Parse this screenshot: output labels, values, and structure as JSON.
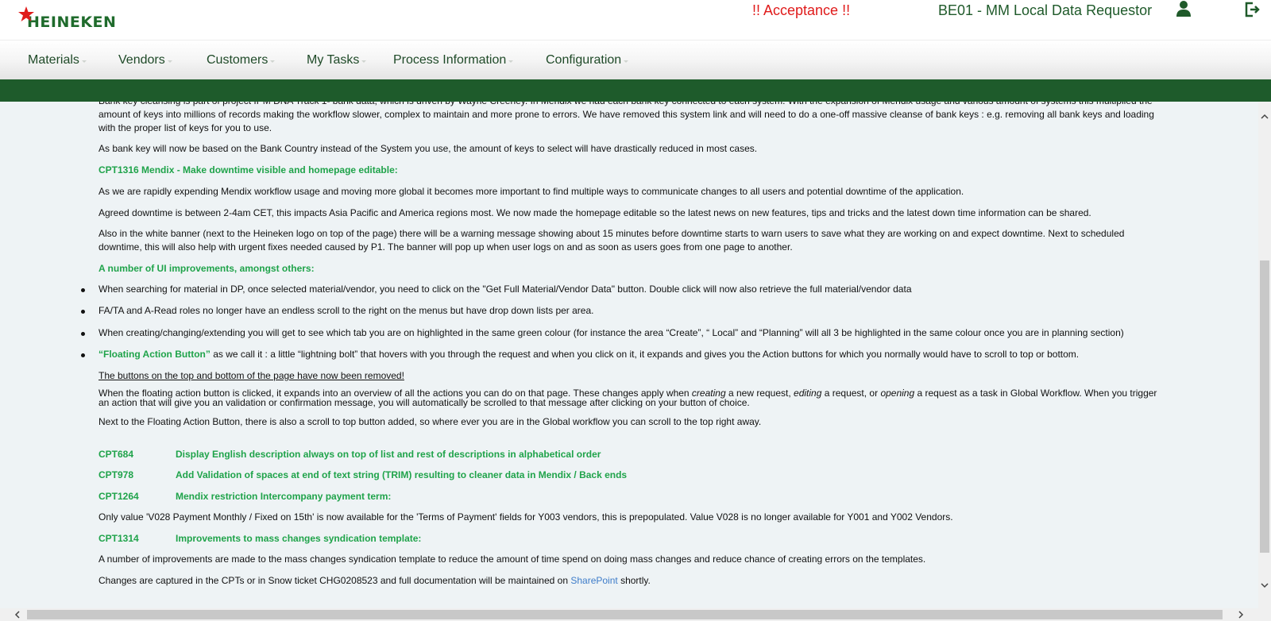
{
  "header": {
    "brand": "HEINEKEN",
    "env_warning": "!! Acceptance !!",
    "role_label": "BE01 - MM Local Data Requestor",
    "user_icon": "user-icon",
    "logout_icon": "logout-icon",
    "colors": {
      "brand_green": "#1f6b2c",
      "warning_red": "#e01b1b",
      "green_bar": "#1e5b2b",
      "highlight_green": "#1fa34a"
    }
  },
  "nav": {
    "items": [
      {
        "label": "Materials"
      },
      {
        "label": "Vendors"
      },
      {
        "label": "Customers"
      },
      {
        "label": "My Tasks"
      },
      {
        "label": "Process Information"
      },
      {
        "label": "Configuration"
      }
    ]
  },
  "content": {
    "intro": "Bank key cleansing is part of project IPM DNA Track 1- bank data, which is driven by Wayne Creeney. In Mendix we had each bank key connected to each system. With the expansion of Mendix usage and various amount of systems this multiplied the amount of keys into millions of records making the workflow slower, complex to maintain and more prone to errors. We have removed this system link and will need to do a one-off massive cleanse of bank keys : e.g. removing all bank keys and loading with the proper list of keys for you to use.",
    "bank_country": "As bank key will now be based on the Bank Country instead of the System you use, the amount of keys to select will have drastically reduced in most cases.",
    "cpt1316_heading": "CPT1316  Mendix - Make downtime visible and homepage editable:",
    "cpt1316_p1": "As we are rapidly expending Mendix workflow usage and moving more global it becomes more important to find multiple ways to communicate changes to all users and potential downtime of the application.",
    "cpt1316_p2": "Agreed downtime is between 2-4am CET, this impacts Asia Pacific and America regions most. We now made the homepage editable so the latest news on new features, tips and tricks and the latest down time information can be shared.",
    "cpt1316_p3": "Also in the white banner (next to the Heineken logo on top of the page) there will be a warning message showing about 15 minutes before downtime starts to warn users to save what they are working on and expect downtime. Next to scheduled downtime, this will also help with urgent fixes needed caused by P1. The banner will pop up when user logs on and as soon as users goes from one page to another.",
    "ui_heading": "A number of UI improvements, amongst others:",
    "bullets": [
      "When searching for material in DP, once selected material/vendor, you need to click on the \"Get Full Material/Vendor Data\" button. Double click will now also retrieve the full material/vendor data",
      "FA/TA and A-Read roles no longer have an endless scroll to the right on the menus but have drop down lists per area.",
      "When creating/changing/extending you will get to see which tab you are on highlighted in the same green colour (for instance the area “Create”, “ Local”  and  “Planning” will all 3 be highlighted in the same colour once you are in planning section)"
    ],
    "fab_label": "“Floating Action Button”",
    "fab_text": " as we call it :  a little “lightning bolt” that hovers with you through the request and when you click on it, it expands and gives you the Action buttons for which you normally would have to scroll to top or bottom.",
    "removed_note": "The buttons on the top and bottom of the page have now been removed!",
    "fab_detail_1": "When the floating action button is clicked, it expands into an overview of all the actions you can do on that page. These changes apply when ",
    "fab_detail_em1": "creating",
    "fab_detail_2": " a new request, ",
    "fab_detail_em2": "editing",
    "fab_detail_3": " a request, or ",
    "fab_detail_em3": "opening",
    "fab_detail_4": " a request as a task in Global Workflow. When you trigger an action that will give you an validation or confirmation message, you will automatically be scrolled to that message after clicking on your button of choice.",
    "scroll_top_note": "Next to the Floating Action Button, there is also a scroll to top button added, so where ever you are in the Global workflow you can scroll to the top right away.",
    "cpts": [
      {
        "id": "CPT684",
        "title": "Display English description always on top of list and rest of descriptions in alphabetical order"
      },
      {
        "id": "CPT978",
        "title": "Add Validation of spaces at end of text string (TRIM) resulting to cleaner data in Mendix / Back ends"
      },
      {
        "id": "CPT1264",
        "title": "Mendix restriction Intercompany payment term:"
      }
    ],
    "cpt1264_text": "Only value 'V028 Payment Monthly / Fixed on 15th' is now available for the 'Terms of Payment' fields for Y003 vendors, this is prepopulated. Value V028 is no longer available for Y001 and Y002 Vendors.",
    "cpt1314": {
      "id": "CPT1314",
      "title": "Improvements to mass changes syndication template:"
    },
    "cpt1314_text": "A number of improvements are made to the mass changes syndication template to reduce the amount of time spend on doing mass changes and reduce chance of creating errors on the templates.",
    "changes_text_1": "Changes are captured in the CPTs or in Snow ticket CHG0208523 and full documentation will be maintained on ",
    "sharepoint_link": "SharePoint",
    "changes_text_2": " shortly."
  },
  "scrollbars": {
    "up_icon": "chevron-up-icon",
    "down_icon": "chevron-down-icon",
    "left_icon": "chevron-left-icon",
    "right_icon": "chevron-right-icon"
  }
}
